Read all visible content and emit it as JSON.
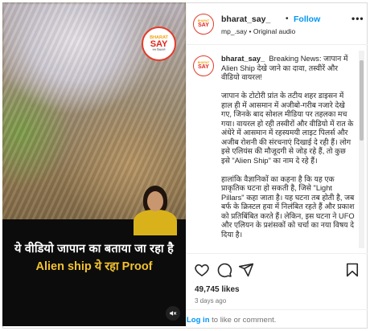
{
  "media": {
    "logo": {
      "line1": "BHARAT",
      "line2": "SAY",
      "line3": "सच दिखाएंगे"
    },
    "caption_line1": "ये वीडियो जापान का बताया जा रहा है",
    "caption_line2": "Alien ship  ये रहा Proof",
    "mute_icon": "speaker-muted-icon"
  },
  "post": {
    "username": "bharat_say_",
    "separator": "•",
    "follow_label": "Follow",
    "subline": "mp_.say • Original audio",
    "more_icon": "•••",
    "avatar": {
      "line1": "BHARAT",
      "line2": "SAY"
    }
  },
  "caption": {
    "username": "bharat_say_",
    "body": "  Breaking News: जापान में Alien Ship देखे जाने का दावा, तस्वीरें और वीडियो वायरल!\n\nजापान के टोटोरी प्रांत के तटीय शहर डाइसन में हाल ही में आसमान में अजीबो-गरीब नजारे देखे गए, जिनके बाद सोशल मीडिया पर तहलका मच गया। वायरल हो रही तस्वीरों और वीडियो में रात के अंधेरे में आसमान में रहस्यमयी लाइट पिलर्स और अजीब रोशनी की संरचनाएं दिखाई दे रही हैं। लोग इसे एलियंस की मौजूदगी से जोड़ रहे हैं, तो कुछ इसे \"Alien Ship\" का नाम दे रहे हैं।\n\nहालांकि वैज्ञानिकों का कहना है कि यह एक प्राकृतिक घटना हो सकती है, जिसे \"Light Pillars\" कहा जाता है। यह घटना तब होती है, जब बर्फ के क्रिस्टल हवा में निलंबित रहते हैं और प्रकाश को प्रतिबिंबित करते हैं। लेकिन, इस घटना ने UFO और एलियन के प्रशंसकों को चर्चा का नया विषय दे दिया है।"
  },
  "actions": {
    "like_icon": "heart-icon",
    "comment_icon": "comment-icon",
    "share_icon": "share-icon",
    "save_icon": "bookmark-icon"
  },
  "likes": "49,745 likes",
  "time_ago": "3 days ago",
  "login": {
    "link": "Log in",
    "rest": " to like or comment."
  }
}
